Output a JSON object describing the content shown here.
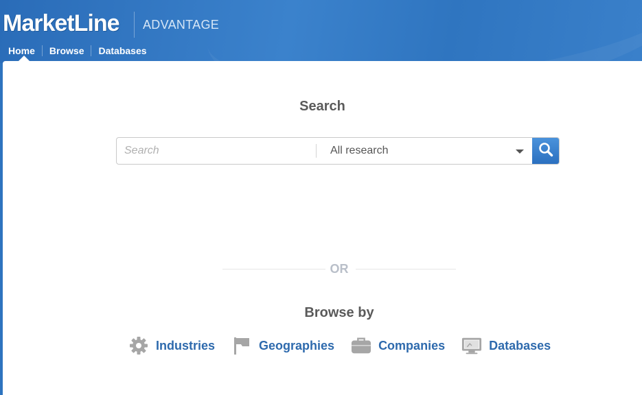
{
  "header": {
    "logo_text": "MarketLine",
    "logo_suffix": "ADVANTAGE"
  },
  "nav": {
    "items": [
      {
        "label": "Home",
        "active": true
      },
      {
        "label": "Browse",
        "active": false
      },
      {
        "label": "Databases",
        "active": false
      }
    ]
  },
  "search": {
    "title": "Search",
    "placeholder": "Search",
    "scope_selected": "All research",
    "button_icon": "magnifier-icon"
  },
  "divider": {
    "label": "OR"
  },
  "browse": {
    "title": "Browse by",
    "items": [
      {
        "label": "Industries",
        "icon": "gear-icon"
      },
      {
        "label": "Geographies",
        "icon": "flag-icon"
      },
      {
        "label": "Companies",
        "icon": "briefcase-icon"
      },
      {
        "label": "Databases",
        "icon": "monitor-icon"
      }
    ]
  },
  "colors": {
    "header_blue": "#2e74bf",
    "link_blue": "#2e6aad",
    "icon_gray": "#a6a6a6",
    "heading_gray": "#5a5a5a"
  }
}
